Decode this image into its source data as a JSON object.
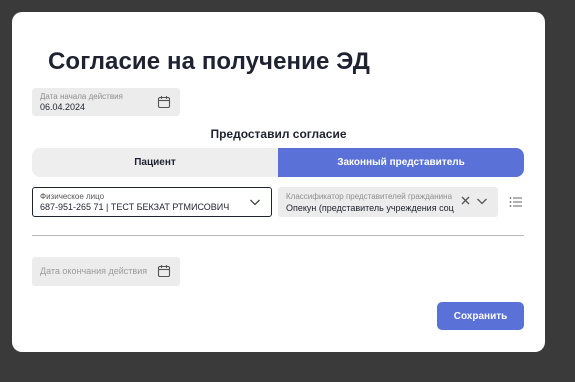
{
  "dialog": {
    "title": "Согласие на получение ЭД",
    "start_date": {
      "label": "Дата начала действия",
      "value": "06.04.2024",
      "icon": "calendar-icon"
    },
    "consent_section_label": "Предоставил согласие",
    "tabs": [
      {
        "label": "Пациент",
        "selected": false
      },
      {
        "label": "Законный представитель",
        "selected": true
      }
    ],
    "person_select": {
      "label": "Физическое лицо",
      "value": "687-951-265 71 | ТЕСТ БЕКЗАТ РТМИСОВИЧ"
    },
    "classifier_select": {
      "label": "Классификатор представителей гражданина",
      "value": "Опекун (представитель учреждения соц"
    },
    "end_date": {
      "label": "Дата окончания действия",
      "icon": "calendar-icon"
    },
    "save_label": "Сохранить"
  },
  "colors": {
    "accent": "#5a72d8",
    "backdrop": "#3a3a3a",
    "field_bg": "#ececec",
    "text": "#1f2230"
  }
}
